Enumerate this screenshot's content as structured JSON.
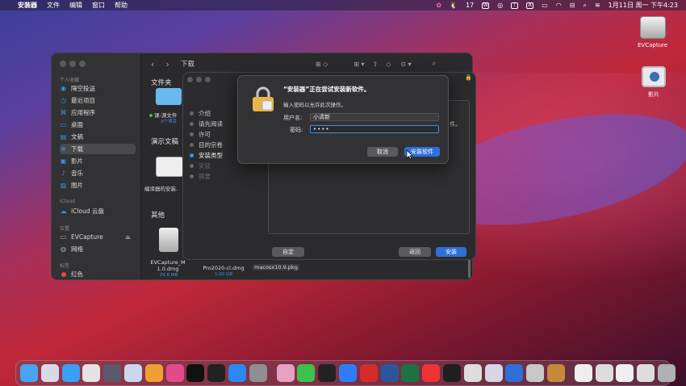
{
  "menubar": {
    "app_name": "安装器",
    "menus": [
      "文件",
      "编辑",
      "窗口",
      "帮助"
    ],
    "badge_count": "17",
    "datetime": "1月11日 周一 下午4:23"
  },
  "desktop": {
    "icons": [
      {
        "label": "EVCapture",
        "icon": "disk-icon"
      },
      {
        "label": "影片",
        "icon": "movie-folder-icon"
      }
    ]
  },
  "finder": {
    "sidebar": {
      "favorites_header": "个人收藏",
      "favorites": [
        "隔空投送",
        "最近项目",
        "应用程序",
        "桌面",
        "文稿",
        "下载",
        "影片",
        "音乐",
        "图片"
      ],
      "selected": "下载",
      "icloud_header": "iCloud",
      "icloud_items": [
        "iCloud 云盘"
      ],
      "locations_header": "位置",
      "locations": [
        "EVCapture",
        "网络"
      ],
      "tags_header": "标签",
      "tags": [
        "红色"
      ]
    },
    "title": "下载",
    "sections": [
      {
        "title": "文件夹"
      },
      {
        "title": "演示文稿"
      },
      {
        "title": "其他"
      }
    ],
    "files": {
      "folder1_name": "课-源文件",
      "folder1_sub": "3个项目",
      "pres1_name": "编译器的安装.",
      "dmg1_name": "EVCapture_M 1.0.dmg",
      "dmg1_size": "24.6 MB",
      "dmg2_name": "Pro2020-cl.dmg",
      "dmg2_size": "1.93 GB",
      "pkg1_name": "macosx10.9.pkg"
    }
  },
  "installer": {
    "steps": [
      {
        "label": "介绍",
        "state": "done"
      },
      {
        "label": "请先阅读",
        "state": "done"
      },
      {
        "label": "许可",
        "state": "done"
      },
      {
        "label": "目的宗卷",
        "state": "done"
      },
      {
        "label": "安装类型",
        "state": "current"
      },
      {
        "label": "安装",
        "state": "pending"
      },
      {
        "label": "摘要",
        "state": "pending"
      }
    ],
    "pane_fragment": "件。",
    "customize_button": "自定",
    "back_button": "返回",
    "install_button": "安装"
  },
  "auth_dialog": {
    "title": "“安装器”正在尝试安装新软件。",
    "message": "输入密码以允许此次操作。",
    "username_label": "用户名:",
    "username_value": "小清新",
    "password_label": "密码:",
    "password_value": "••••",
    "cancel_button": "取消",
    "confirm_button": "安装软件"
  },
  "dock": {
    "apps": [
      "finder-icon",
      "launchpad-icon",
      "safari-icon",
      "pinwheel-icon",
      "imovie-icon",
      "preview-icon",
      "photos-icon",
      "photo-icon",
      "appletv-icon",
      "games-icon",
      "appstore-icon",
      "system-preferences-icon",
      "keynote-icon",
      "wechat-icon",
      "qq-icon",
      "mail-icon",
      "shortcuts-icon",
      "word-icon",
      "excel-icon",
      "wps-icon",
      "terminal-icon",
      "preview2-icon",
      "flower-icon",
      "quicktime-icon",
      "evcapture-icon",
      "folder-icon",
      "thumbnail1-icon",
      "thumbnail2-icon",
      "thumbnail3-icon",
      "thumbnail4-icon",
      "trash-icon"
    ]
  }
}
